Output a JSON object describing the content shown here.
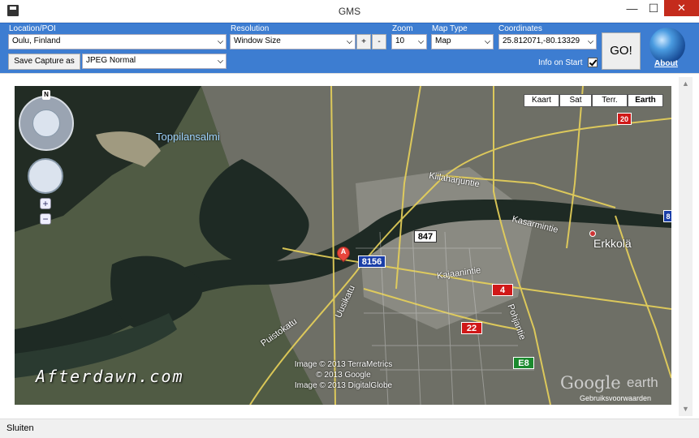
{
  "window": {
    "title": "GMS",
    "minimize": "—",
    "maximize": "☐",
    "close": "✕"
  },
  "toolbar": {
    "location_label": "Location/POI",
    "location_value": "Oulu, Finland",
    "save_capture_label": "Save Capture as",
    "format_value": "JPEG Normal",
    "resolution_label": "Resolution",
    "resolution_value": "Window Size",
    "plus_label": "+",
    "minus_label": "-",
    "zoom_label": "Zoom",
    "zoom_value": "10",
    "maptype_label": "Map Type",
    "maptype_value": "Map",
    "coordinates_label": "Coordinates",
    "coordinates_value": "25.812071,-80.13329",
    "go_label": "GO!",
    "info_on_start_label": "Info on Start",
    "info_on_start_checked": true,
    "about_label": "About"
  },
  "map": {
    "type_buttons": [
      "Kaart",
      "Sat",
      "Terr.",
      "Earth"
    ],
    "active_type": "Earth",
    "compass_label": "N",
    "zoom_in": "+",
    "zoom_out": "−",
    "place_labels": {
      "toppilansalmi": "Toppilansalmi",
      "erkkola": "Erkkolä",
      "kajaanintie": "Kajaanintie",
      "kasarmintie": "Kasarmintie",
      "puistokatu": "Puistokatu",
      "uusikatu": "Uusikatu",
      "pohjantie": "Pohjantie",
      "kirkkokatu": "Kiilaharjuntie"
    },
    "shields": {
      "s20": "20",
      "s847": "847",
      "s8156": "8156",
      "s4": "4",
      "s22": "22",
      "e8": "E8",
      "s8": "8"
    },
    "marker_letter": "A",
    "copyright": [
      "Image © 2013 TerraMetrics",
      "© 2013 Google",
      "Image © 2013 DigitalGlobe"
    ],
    "watermark": "Afterdawn.com",
    "google_logo": "Google",
    "earth_word": "earth",
    "terms": "Gebruiksvoorwaarden"
  },
  "status": {
    "text": "Sluiten"
  },
  "colors": {
    "toolbar": "#3d7dd1",
    "close": "#c42b1c",
    "shield_red": "#d01818",
    "shield_blue": "#1a3ea8",
    "shield_green": "#1b8a2e"
  }
}
